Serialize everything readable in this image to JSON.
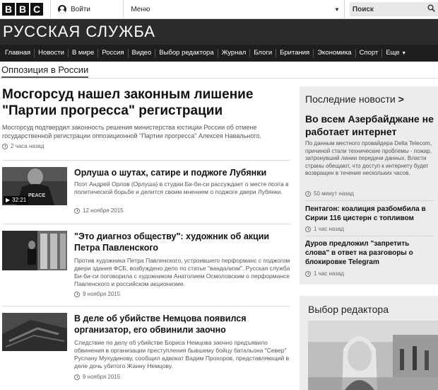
{
  "topbar": {
    "logo_letters": [
      "B",
      "B",
      "C"
    ],
    "signin_label": "Войти",
    "menu_label": "Меню",
    "search_label": "Поиск"
  },
  "masthead": {
    "title": "РУССКАЯ СЛУЖБА"
  },
  "nav": {
    "items": [
      "Главная",
      "Новости",
      "В мире",
      "Россия",
      "Видео",
      "Выбор редактора",
      "Журнал",
      "Блоги",
      "Британия",
      "Экономика",
      "Спорт",
      "Еще"
    ]
  },
  "section": {
    "label": "Оппозиция в России"
  },
  "lead": {
    "title": "Мосгорсуд нашел законным лишение \"Партии прогресса\" регистрации",
    "summary": "Мосгорсуд подтвердил законность решения министерства юстиции России об отмене государственной регистрации оппозиционной \"Партии прогресса\" Алексея Навального.",
    "time": "2 часа назад"
  },
  "stories": [
    {
      "title": "Орлуша о шутах, сатире и поджоге Лубянки",
      "summary": "Поэт Андрей Орлов (Орлуша) в студии Би-би-си рассуждает о месте поэта в политической борьбе и делится своим мнением о поджоге двери Лубянки.",
      "time": "12 ноября 2015",
      "video_duration": "32:21",
      "thumb_text": "PEACE"
    },
    {
      "title": "\"Это диагноз обществу\": художник об акции Петра Павленского",
      "summary": "Против художника Петра Павленского, устроившего перформанс с поджогом двери здания ФСБ, возбуждено дело по статье \"вандализм\". Русская служба Би-би-си поговорила с художником Анатолием Осмоловским о перформансе Павленского и российском акционизме.",
      "time": "9 ноября 2015"
    },
    {
      "title": "В деле об убийстве Немцова появился организатор, его обвинили заочно",
      "summary": "Следствие по делу об убийстве Бориса Немцова заочно предъявило обвинения в организации преступления бывшему бойцу батальона \"Север\" Руслану Мухудинову, сообщил адвокат Вадим Прохоров, представляющий в деле дочь убитого Жанну Немцову.",
      "time": "9 ноября 2015"
    }
  ],
  "sidebar": {
    "heading": "Последние новости",
    "heading_arrow": ">",
    "lead_title": "Во всем Азербайджане не работает интернет",
    "lead_summary": "По данным местного провайдера Delta Telecom, причиной стали технические проблемы - пожар, затронувший линии передачи данных. Власти страны обещают, что доступ к интернету будет возвращен в течение нескольких часов.",
    "lead_time": "50 минут назад",
    "items": [
      {
        "title": "Пентагон: коалиция разбомбила в Сирии 116 цистерн с топливом",
        "time": "1 час назад"
      },
      {
        "title": "Дуров предложил \"запретить слова\" в ответ на разговоры о блокировке Telegram",
        "time": "1 час назад"
      }
    ]
  },
  "picks": {
    "heading": "Выбор редактора"
  },
  "colors": {
    "masthead_bg": "#2b2b2b",
    "nav_bg": "#1e1e1e",
    "sidebar_bg": "#ececec"
  }
}
